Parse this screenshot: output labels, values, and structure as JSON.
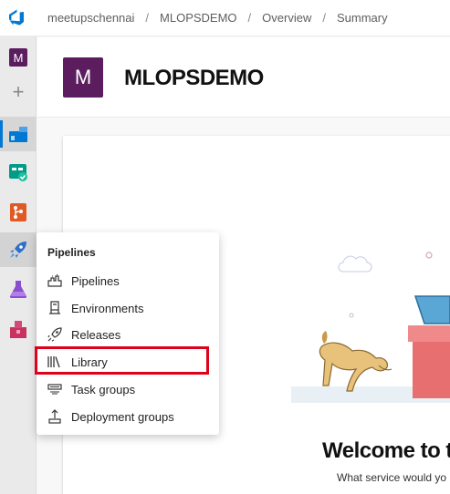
{
  "breadcrumb": [
    "meetupschennai",
    "MLOPSDEMO",
    "Overview",
    "Summary"
  ],
  "breadcrumb_separator": "/",
  "rail": {
    "project_initial": "M",
    "items": [
      {
        "name": "overview-icon"
      },
      {
        "name": "boards-icon"
      },
      {
        "name": "repos-icon"
      },
      {
        "name": "pipelines-icon"
      },
      {
        "name": "test-plans-icon"
      },
      {
        "name": "artifacts-icon"
      }
    ]
  },
  "project": {
    "initial": "M",
    "title": "MLOPSDEMO",
    "avatar_color": "#5c1d5f"
  },
  "flyout": {
    "title": "Pipelines",
    "items": [
      {
        "label": "Pipelines",
        "icon": "pipelines-icon"
      },
      {
        "label": "Environments",
        "icon": "environments-icon"
      },
      {
        "label": "Releases",
        "icon": "releases-icon"
      },
      {
        "label": "Library",
        "icon": "library-icon",
        "highlighted": true
      },
      {
        "label": "Task groups",
        "icon": "task-groups-icon"
      },
      {
        "label": "Deployment groups",
        "icon": "deployment-groups-icon"
      }
    ]
  },
  "welcome": {
    "title": "Welcome to t",
    "subtitle": "What service would yo"
  },
  "colors": {
    "accent": "#0078d4",
    "highlight": "#e0001b",
    "project": "#5c1d5f"
  }
}
